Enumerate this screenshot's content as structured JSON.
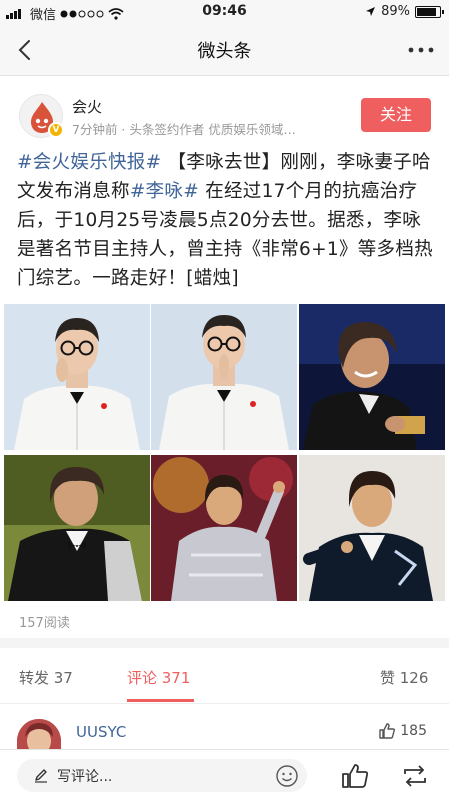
{
  "status_bar": {
    "carrier": "微信",
    "time": "09:46",
    "battery": "89%",
    "battery_level": 0.89
  },
  "nav": {
    "title": "微头条",
    "back_icon": "chevron-left-icon",
    "more_icon": "more-dots-icon"
  },
  "author": {
    "name": "会火",
    "meta": "7分钟前 · 头条签约作者 优质娱乐领域…",
    "follow_label": "关注",
    "badge": "V"
  },
  "article": {
    "tag1": "#会火娱乐快报#",
    "text1": " 【李咏去世】刚刚，李咏妻子哈文发布消息称",
    "tag2": "#李咏#",
    "text2": " 在经过17个月的抗癌治疗后，于10月25号凌晨5点20分去世。据悉，李咏是著名节目主持人，曾主持《非常6+1》等多档热门综艺。一路走好！[蜡烛]"
  },
  "photos": [
    {
      "name": "photo-1"
    },
    {
      "name": "photo-2"
    },
    {
      "name": "photo-3"
    },
    {
      "name": "photo-4"
    },
    {
      "name": "photo-5"
    },
    {
      "name": "photo-6"
    }
  ],
  "reads": "157阅读",
  "actions": {
    "repost": "转发 37",
    "comments": "评论 371",
    "likes": "赞 126"
  },
  "comment": {
    "username": "UUSYC",
    "like_count": "185"
  },
  "bottom_bar": {
    "placeholder": "写评论...",
    "icons": [
      "pen-icon",
      "emoji-icon",
      "thumbs-up-icon",
      "repost-icon"
    ]
  },
  "colors": {
    "accent": "#f05f5f",
    "link": "#406599",
    "muted": "#999999"
  }
}
